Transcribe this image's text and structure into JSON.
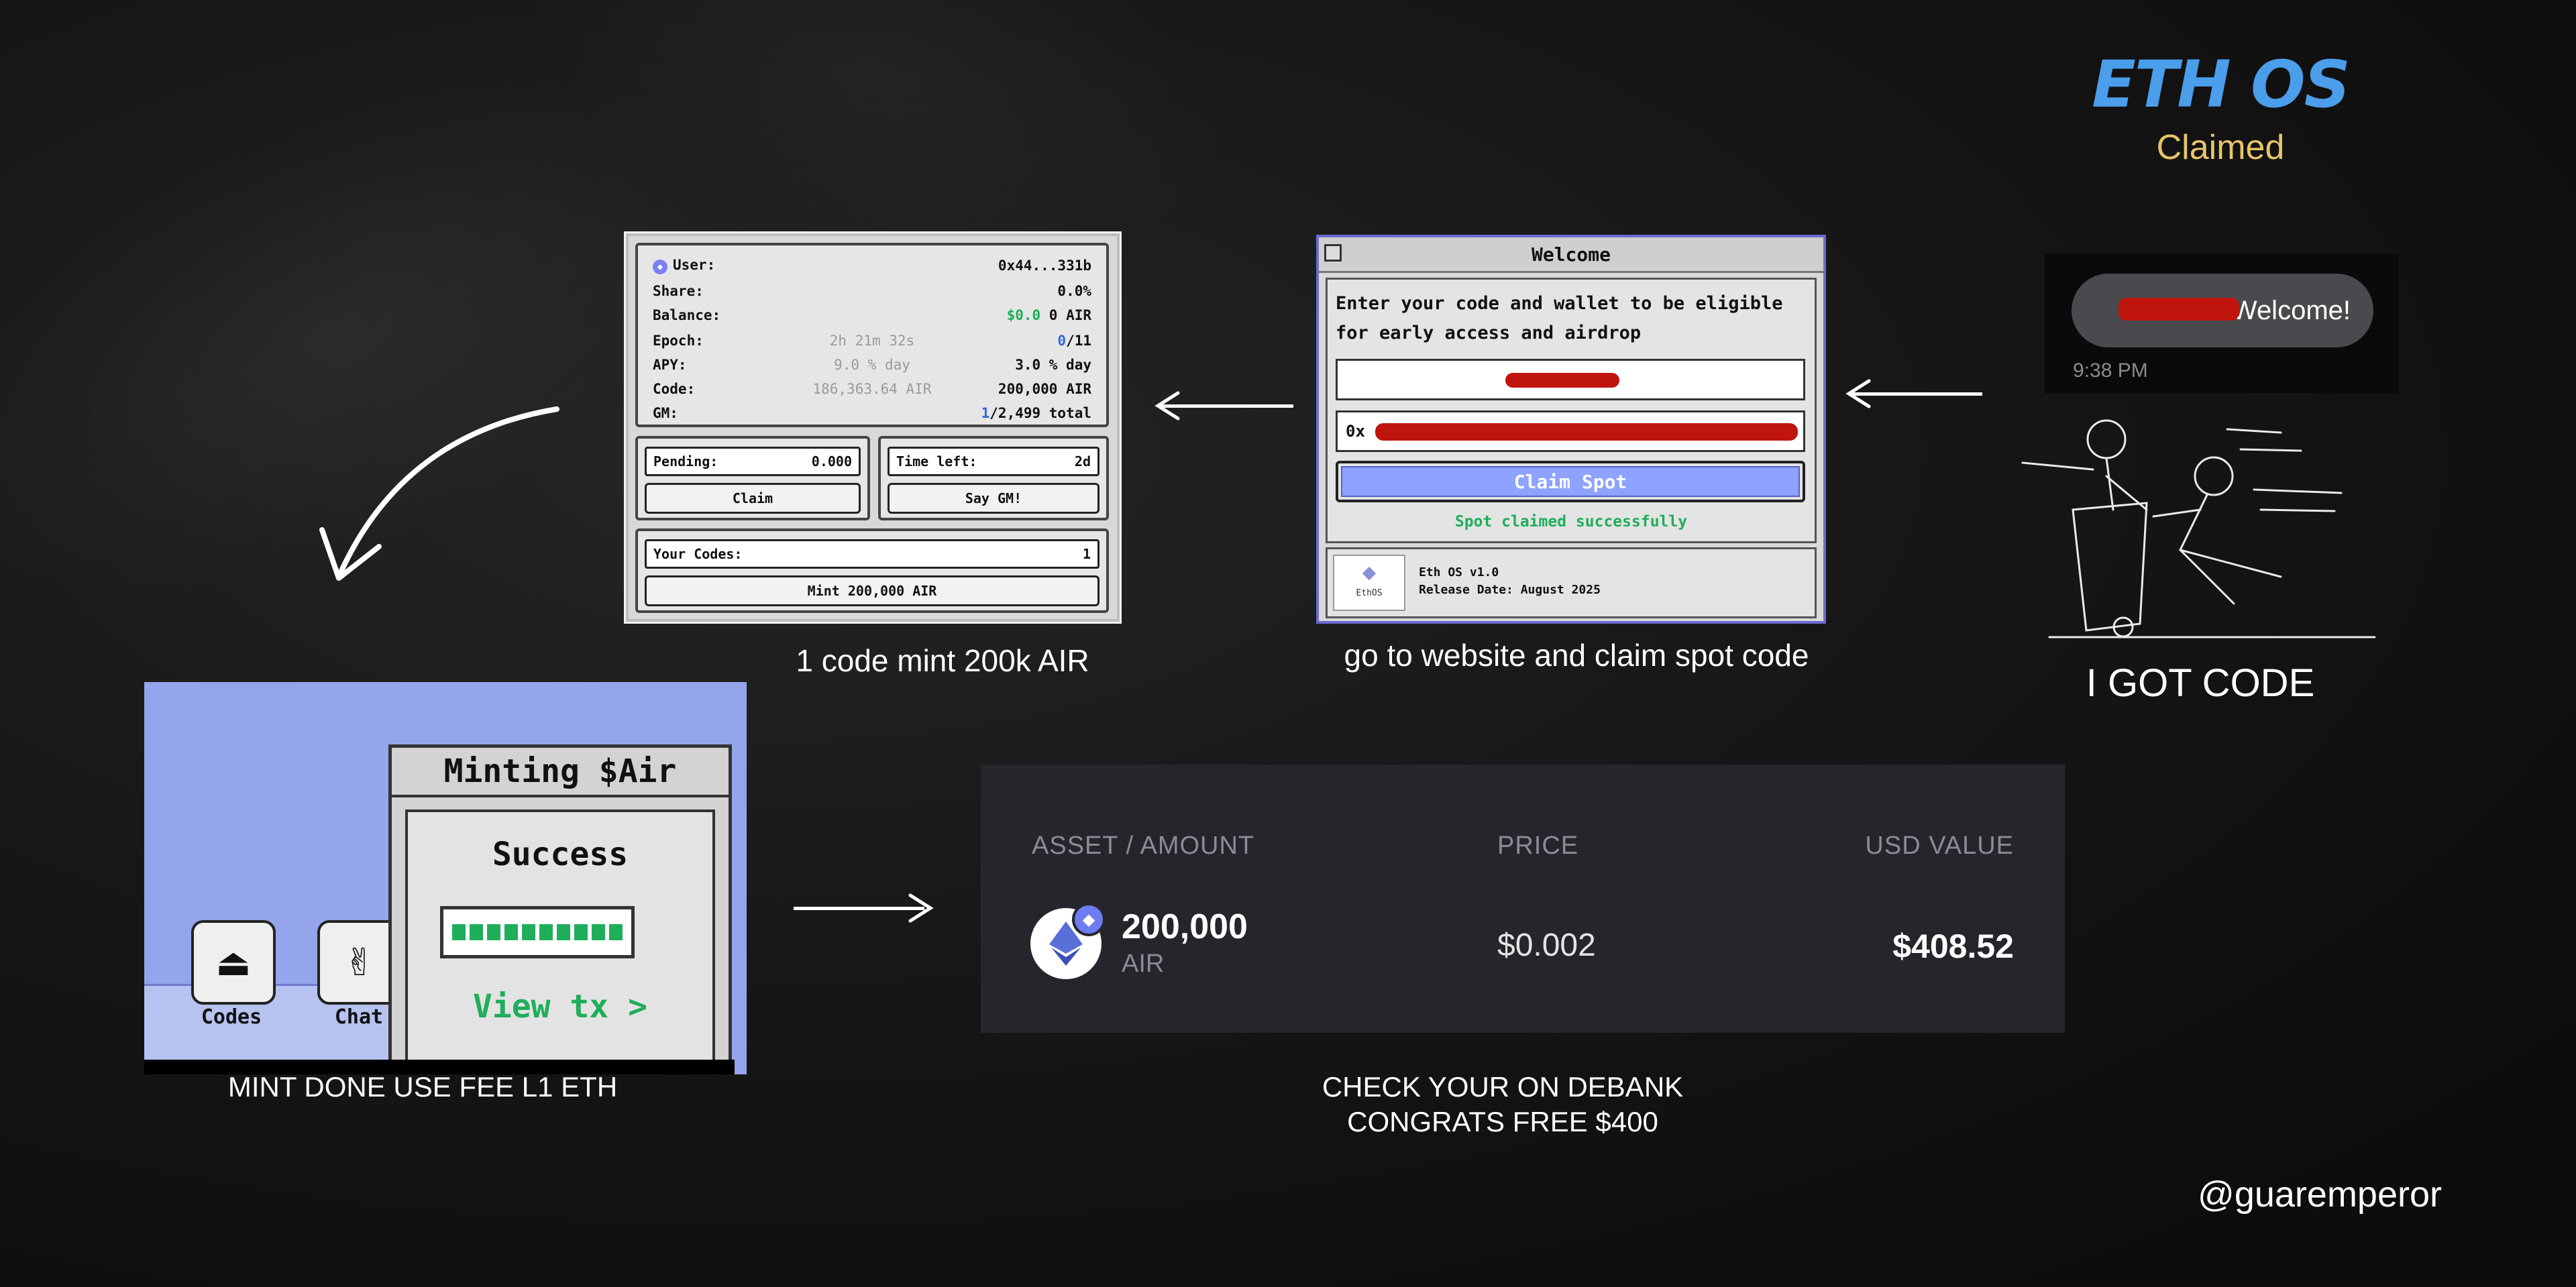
{
  "brand": {
    "title": "ETH OS",
    "subtitle": "Claimed"
  },
  "stats_panel": {
    "rows": [
      {
        "key": "User:",
        "mid": "",
        "value": "0x44...331b"
      },
      {
        "key": "Share:",
        "mid": "",
        "value": "0.0%"
      },
      {
        "key": "Balance:",
        "mid": "",
        "value_green": "$0.0",
        "value": " 0 AIR"
      },
      {
        "key": "Epoch:",
        "mid": "2h 21m 32s",
        "value_blue": "0",
        "value": "/11"
      },
      {
        "key": "APY:",
        "mid": "9.0 % day",
        "value": "3.0 % day"
      },
      {
        "key": "Code:",
        "mid": "186,363.64 AIR",
        "value": "200,000 AIR"
      },
      {
        "key": "GM:",
        "mid": "",
        "value_blue": "1",
        "value": "/2,499 total"
      }
    ],
    "pending_label": "Pending:",
    "pending_value": "0.000",
    "time_left_label": "Time left:",
    "time_left_value": "2d",
    "claim_label": "Claim",
    "say_gm_label": "Say GM!",
    "your_codes_label": "Your Codes:",
    "your_codes_value": "1",
    "mint_label": "Mint 200,000 AIR"
  },
  "welcome_window": {
    "title": "Welcome",
    "instructions": "Enter your code and wallet to be eligible for early access and airdrop",
    "wallet_prefix": "0x",
    "claim_button": "Claim Spot",
    "success_message": "Spot claimed successfully",
    "version": "Eth OS v1.0",
    "release_date": "Release Date: August 2025",
    "logo_text": "EthOS"
  },
  "chat": {
    "message": "Welcome!",
    "time": "9:38 PM"
  },
  "captions": {
    "mint_code": "1 code mint 200k AIR",
    "go_website": "go to website and claim spot code",
    "got_code": "I GOT CODE",
    "mint_done": "MINT DONE USE FEE L1 ETH",
    "check_debank_line1": "CHECK YOUR ON DEBANK",
    "check_debank_line2": "CONGRATS FREE $400"
  },
  "minting_window": {
    "title": "Minting $Air",
    "status": "Success",
    "view_tx": "View tx >",
    "progress": 1.0,
    "dock": [
      {
        "label": "Codes",
        "icon": "eject-icon"
      },
      {
        "label": "Chat",
        "icon": "peace-hand-icon"
      }
    ]
  },
  "debank": {
    "headers": {
      "asset": "ASSET / AMOUNT",
      "price": "PRICE",
      "usd": "USD VALUE"
    },
    "row": {
      "amount": "200,000",
      "symbol": "AIR",
      "price": "$0.002",
      "usd_value": "$408.52"
    }
  },
  "handle": "@guaremperor",
  "colors": {
    "brand_blue": "#4a9eea",
    "brand_yellow": "#e9c46a",
    "success_green": "#1fae5a",
    "claim_blue": "#8ea2ff"
  }
}
